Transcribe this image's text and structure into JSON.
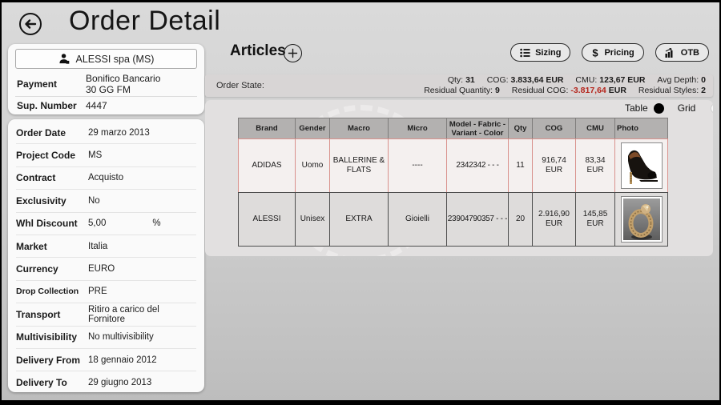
{
  "header": {
    "title": "Order Detail"
  },
  "sidebar": {
    "customer": "ALESSI spa (MS)",
    "top_fields": [
      {
        "label": "Payment",
        "value": "Bonifico Bancario\n30 GG FM"
      },
      {
        "label": "Sup. Number",
        "value": "4447"
      }
    ],
    "fields": [
      {
        "label": "Order Date",
        "value": "29 marzo 2013"
      },
      {
        "label": "Project Code",
        "value": "MS"
      },
      {
        "label": "Contract",
        "value": "Acquisto"
      },
      {
        "label": "Exclusivity",
        "value": "No"
      },
      {
        "label": "Whl Discount",
        "value": "5,00",
        "suffix": "%"
      },
      {
        "label": "Market",
        "value": "Italia"
      },
      {
        "label": "Currency",
        "value": "EURO"
      },
      {
        "label": "Drop Collection",
        "value": "PRE"
      },
      {
        "label": "Transport",
        "value": "Ritiro a carico del Fornitore"
      },
      {
        "label": "Multivisibility",
        "value": "No multivisibility"
      },
      {
        "label": "Delivery From",
        "value": "18 gennaio 2012"
      },
      {
        "label": "Delivery To",
        "value": "29 giugno 2013"
      }
    ]
  },
  "articles": {
    "title": "Articles",
    "add_label": "+",
    "toolbar": [
      {
        "label": "Sizing",
        "icon": "list-icon"
      },
      {
        "label": "Pricing",
        "icon": "dollar-icon"
      },
      {
        "label": "OTB",
        "icon": "chart-icon"
      }
    ],
    "order_state": {
      "label": "Order State:",
      "line1": [
        {
          "label": "Qty:",
          "value": "31"
        },
        {
          "label": "COG:",
          "value": "3.833,64 EUR"
        },
        {
          "label": "CMU:",
          "value": "123,67 EUR"
        },
        {
          "label": "Avg Depth:",
          "value": "0"
        }
      ],
      "line2": [
        {
          "label": "Residual Quantity:",
          "value": "9"
        },
        {
          "label": "Residual COG:",
          "value": "-3.817,64",
          "suffix": "EUR"
        },
        {
          "label": "Residual Styles:",
          "value": "2"
        }
      ]
    },
    "view_toggle": {
      "table": "Table",
      "grid": "Grid",
      "selected": "Table"
    },
    "table": {
      "columns": [
        "Brand",
        "Gender",
        "Macro",
        "Micro",
        "Model - Fabric - Variant - Color",
        "Qty",
        "COG",
        "CMU",
        "Photo"
      ],
      "rows": [
        {
          "brand": "ADIDAS",
          "gender": "Uomo",
          "macro": "BALLERINE & FLATS",
          "micro": "----",
          "model": "2342342 -  -  -",
          "qty": "11",
          "cog": "916,74 EUR",
          "cmu": "83,34 EUR",
          "photo": "black-high-heel-shoe"
        },
        {
          "brand": "ALESSI",
          "gender": "Unisex",
          "macro": "EXTRA",
          "micro": "Gioielli",
          "model": "23904790357 -  -  -",
          "qty": "20",
          "cog": "2.916,90 EUR",
          "cmu": "145,85 EUR",
          "photo": "gold-ring"
        }
      ]
    }
  },
  "colors": {
    "negative_value": "#b5251c",
    "selected_row_border": "#d9918c",
    "table_header_bg": "#b3b1b0",
    "panel_bg": "#e2e0e0"
  }
}
